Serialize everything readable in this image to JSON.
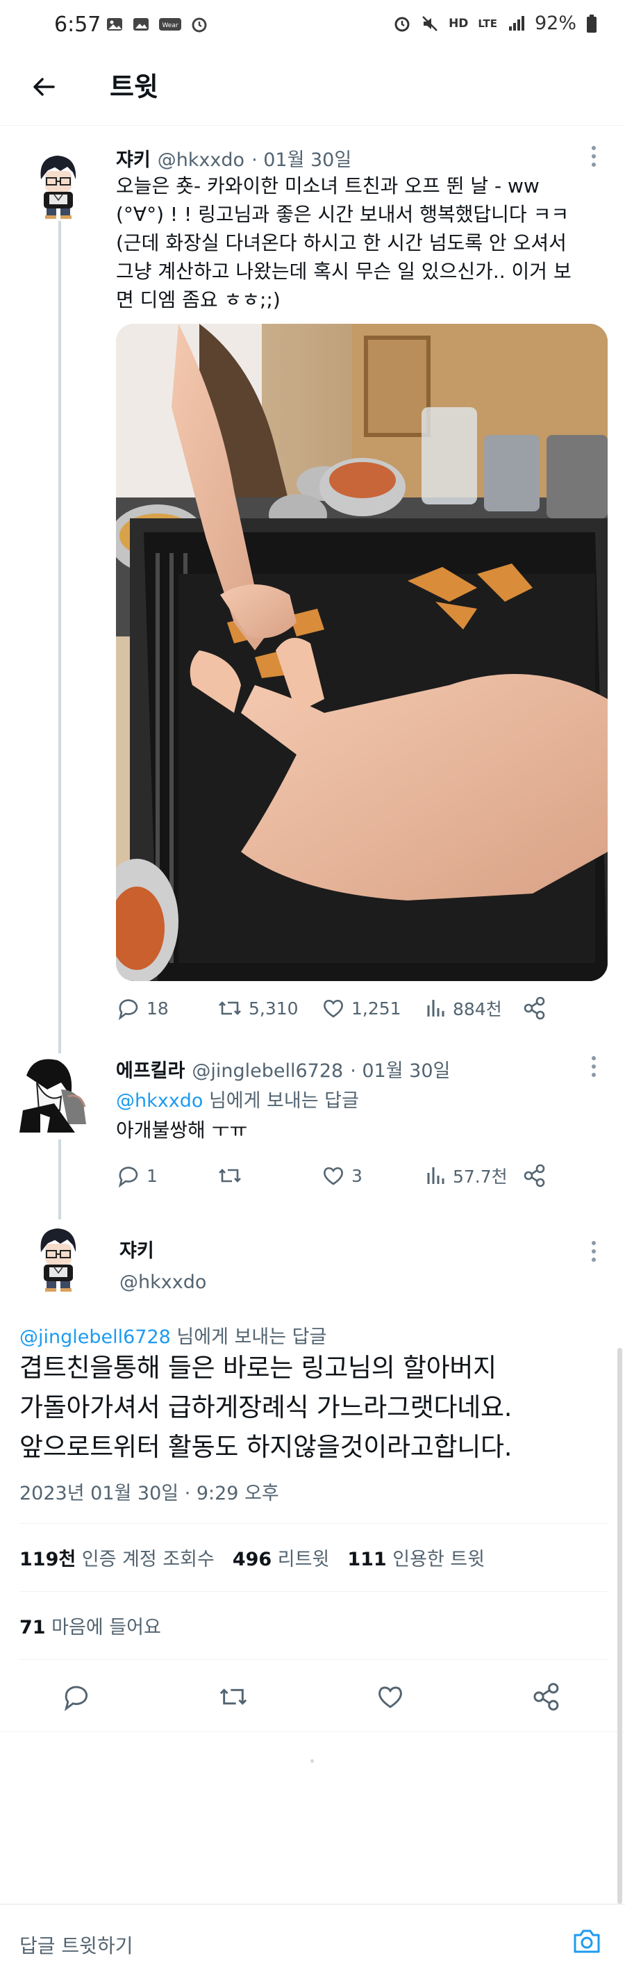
{
  "status_bar": {
    "time": "6:57",
    "left_icons": [
      "photo-icon",
      "gallery-icon",
      "webtoon-icon",
      "alarm-icon"
    ],
    "right_icons": [
      "alarm-icon",
      "mute-icon",
      "hd-voice-icon",
      "lte-icon",
      "signal-icon"
    ],
    "hd_label": "HD",
    "lte_label": "LTE",
    "battery": "92%"
  },
  "app_bar": {
    "title": "트윗"
  },
  "tweets": [
    {
      "name": "쟈키",
      "handle": "@hkxxdo",
      "date": "· 01월 30일",
      "lines": [
        "오늘은 춋- 카와이한 미소녀 트친과 오프 뛴 날 - ww",
        "(°∀°) ! !  링고님과 좋은 시간 보내서 행복했답니다 ㅋㅋ",
        "(근데 화장실 다녀온다 하시고 한 시간 넘도록 안 오셔서",
        "그냥 계산하고 나왔는데 혹시 무슨 일 있으신가.. 이거 보",
        "면 디엠 좀요 ㅎㅎ;;)"
      ],
      "replies": "18",
      "retweets": "5,310",
      "likes": "1,251",
      "views": "884천"
    },
    {
      "name": "에프킬라",
      "handle": "@jinglebell6728",
      "date": "· 01월 30일",
      "reply_to_handle": "@hkxxdo",
      "reply_to_suffix": " 님에게 보내는 답글",
      "text": "아개불쌍해 ㅜㅠ",
      "replies": "1",
      "likes": "3",
      "views": "57.7천"
    }
  ],
  "main_tweet": {
    "name": "쟈키",
    "handle": "@hkxxdo",
    "reply_to_handle": "@jinglebell6728",
    "reply_to_suffix": " 님에게 보내는 답글",
    "lines": [
      "겹트친을통해 들은 바로는 링고님의 할아버지",
      "가돌아가셔서 급하게장례식 가느라그랫다네요.",
      "앞으로트위터 활동도 하지않을것이라고합니다."
    ],
    "timestamp": "2023년 01월 30일 · 9:29 오후",
    "views_num": "119천",
    "views_label": " 인증 계정 조회수",
    "retweets_num": "496",
    "retweets_label": " 리트윗",
    "quotes_num": "111",
    "quotes_label": " 인용한 트윗",
    "likes_num": "71",
    "likes_label": " 마음에 들어요"
  },
  "reply_bar": {
    "placeholder": "답글 트윗하기"
  },
  "colors": {
    "link": "#1d9bf0",
    "text": "#0f1419",
    "secondary": "#536471",
    "divider": "#eff3f4"
  }
}
